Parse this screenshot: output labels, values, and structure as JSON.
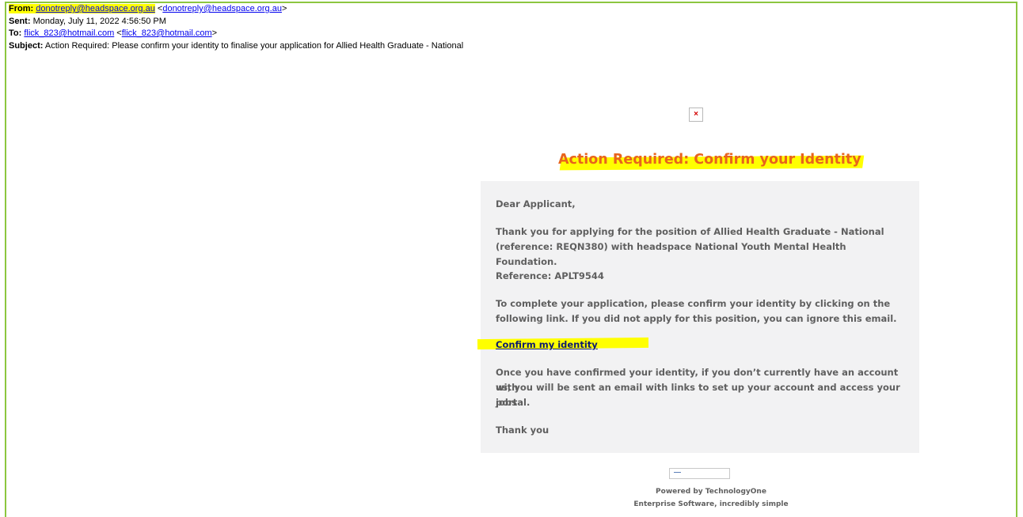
{
  "header": {
    "from_label": "From:",
    "from_address": "donotreply@headspace.org.au",
    "from_bracket_address": "donotreply@headspace.org.au",
    "sent_label": "Sent:",
    "sent_value": "Monday, July 11, 2022 4:56:50 PM",
    "to_label": "To:",
    "to_address": "flick_823@hotmail.com",
    "to_bracket_address": "flick_823@hotmail.com",
    "subject_label": "Subject:",
    "subject_value": "Action Required: Please confirm your identity to finalise your application for Allied Health Graduate - National"
  },
  "email": {
    "title": "Action Required: Confirm your Identity",
    "greeting": "Dear Applicant,",
    "para1_line1": "Thank you for applying for the position of Allied Health Graduate - National",
    "para1_line2": "(reference: REQN380) with headspace National Youth Mental Health Foundation.",
    "reference": "Reference: APLT9544",
    "para2_line1": "To complete your application, please confirm your identity by clicking on the",
    "para2_line2": "following link. If you did not apply for this position, you can ignore this email.",
    "confirm_link": "Confirm my identity",
    "para3_line1": "Once you have confirmed your identity, if you don’t currently have an account with",
    "para3_line2": "us, you will be sent an email with links to set up your account and access your jobs",
    "para3_line3": "portal.",
    "closing": "Thank you"
  },
  "footer": {
    "powered_by": "Powered by TechnologyOne",
    "tagline": "Enterprise Software, incredibly simple"
  },
  "colors": {
    "frame_border": "#8cc63f",
    "highlight": "#ffff00",
    "title_orange": "#e8641c",
    "card_background": "#f2f2f3",
    "body_text": "#5f5f5f",
    "link": "#0000ee"
  },
  "icons": {
    "header_image": "broken-image-icon",
    "footer_logo": "technologyone-logo-image"
  }
}
